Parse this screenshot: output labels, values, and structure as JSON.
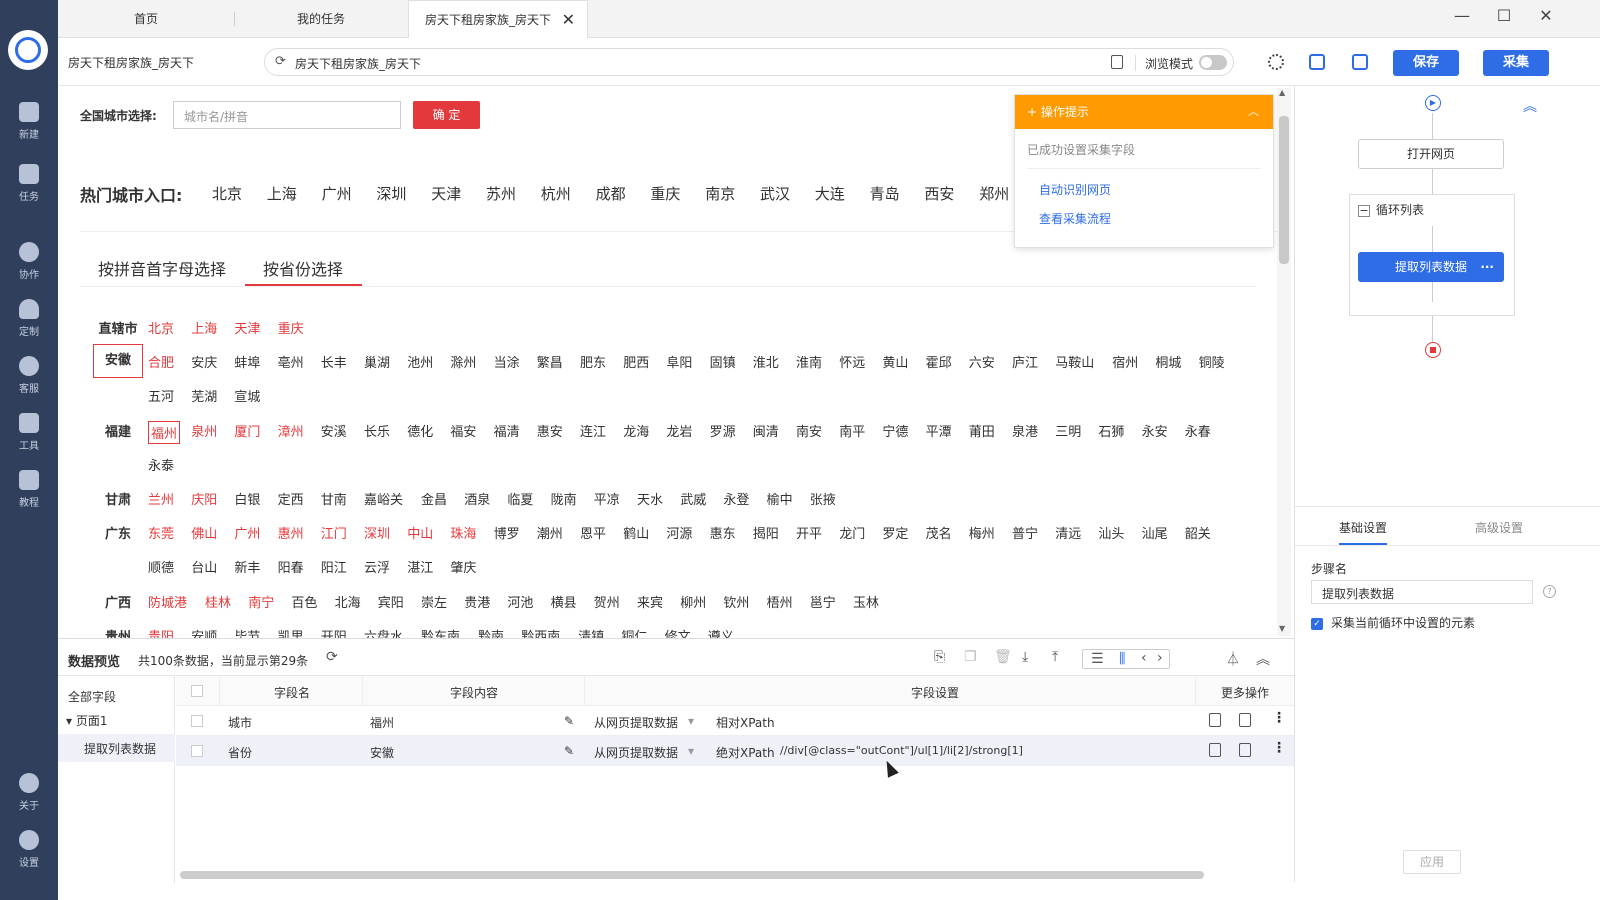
{
  "tabs": {
    "home": "首页",
    "my_tasks": "我的任务",
    "active": "房天下租房家族_房天下"
  },
  "sidebar": {
    "items": [
      {
        "label": "新建"
      },
      {
        "label": "任务"
      },
      {
        "label": "协作"
      },
      {
        "label": "定制"
      },
      {
        "label": "客服"
      },
      {
        "label": "工具"
      },
      {
        "label": "教程"
      },
      {
        "label": "关于"
      },
      {
        "label": "设置"
      }
    ]
  },
  "address": {
    "page_title": "房天下租房家族_房天下",
    "url": "房天下租房家族_房天下",
    "browse_mode": "浏览模式",
    "save": "保存",
    "collect": "采集"
  },
  "web": {
    "city_select_label": "全国城市选择:",
    "city_input_placeholder": "城市名/拼音",
    "confirm": "确 定",
    "hot_label": "热门城市入口:",
    "hot_cities": [
      "北京",
      "上海",
      "广州",
      "深圳",
      "天津",
      "苏州",
      "杭州",
      "成都",
      "重庆",
      "南京",
      "武汉",
      "大连",
      "青岛",
      "西安",
      "郑州"
    ],
    "tab_pinyin": "按拼音首字母选择",
    "tab_province": "按省份选择",
    "provinces": [
      {
        "name": "直辖市",
        "rows": [
          [
            {
              "t": "北京",
              "r": 1
            },
            {
              "t": "上海",
              "r": 1
            },
            {
              "t": "天津",
              "r": 1
            },
            {
              "t": "重庆",
              "r": 1
            }
          ]
        ]
      },
      {
        "name": "安徽",
        "rows": [
          [
            {
              "t": "合肥",
              "r": 1
            },
            {
              "t": "安庆"
            },
            {
              "t": "蚌埠"
            },
            {
              "t": "亳州"
            },
            {
              "t": "长丰"
            },
            {
              "t": "巢湖"
            },
            {
              "t": "池州"
            },
            {
              "t": "滁州"
            },
            {
              "t": "当涂"
            },
            {
              "t": "繁昌"
            },
            {
              "t": "肥东"
            },
            {
              "t": "肥西"
            },
            {
              "t": "阜阳"
            },
            {
              "t": "固镇"
            },
            {
              "t": "淮北"
            },
            {
              "t": "淮南"
            },
            {
              "t": "怀远"
            },
            {
              "t": "黄山"
            },
            {
              "t": "霍邱"
            },
            {
              "t": "六安"
            },
            {
              "t": "庐江"
            },
            {
              "t": "马鞍山"
            },
            {
              "t": "宿州"
            },
            {
              "t": "桐城"
            },
            {
              "t": "铜陵"
            }
          ],
          [
            {
              "t": "五河"
            },
            {
              "t": "芜湖"
            },
            {
              "t": "宣城"
            }
          ]
        ]
      },
      {
        "name": "福建",
        "rows": [
          [
            {
              "t": "福州",
              "r": 1
            },
            {
              "t": "泉州",
              "r": 1
            },
            {
              "t": "厦门",
              "r": 1
            },
            {
              "t": "漳州",
              "r": 1
            },
            {
              "t": "安溪"
            },
            {
              "t": "长乐"
            },
            {
              "t": "德化"
            },
            {
              "t": "福安"
            },
            {
              "t": "福清"
            },
            {
              "t": "惠安"
            },
            {
              "t": "连江"
            },
            {
              "t": "龙海"
            },
            {
              "t": "龙岩"
            },
            {
              "t": "罗源"
            },
            {
              "t": "闽清"
            },
            {
              "t": "南安"
            },
            {
              "t": "南平"
            },
            {
              "t": "宁德"
            },
            {
              "t": "平潭"
            },
            {
              "t": "莆田"
            },
            {
              "t": "泉港"
            },
            {
              "t": "三明"
            },
            {
              "t": "石狮"
            },
            {
              "t": "永安"
            },
            {
              "t": "永春"
            }
          ],
          [
            {
              "t": "永泰"
            }
          ]
        ]
      },
      {
        "name": "甘肃",
        "rows": [
          [
            {
              "t": "兰州",
              "r": 1
            },
            {
              "t": "庆阳",
              "r": 1
            },
            {
              "t": "白银"
            },
            {
              "t": "定西"
            },
            {
              "t": "甘南"
            },
            {
              "t": "嘉峪关"
            },
            {
              "t": "金昌"
            },
            {
              "t": "酒泉"
            },
            {
              "t": "临夏"
            },
            {
              "t": "陇南"
            },
            {
              "t": "平凉"
            },
            {
              "t": "天水"
            },
            {
              "t": "武威"
            },
            {
              "t": "永登"
            },
            {
              "t": "榆中"
            },
            {
              "t": "张掖"
            }
          ]
        ]
      },
      {
        "name": "广东",
        "rows": [
          [
            {
              "t": "东莞",
              "r": 1
            },
            {
              "t": "佛山",
              "r": 1
            },
            {
              "t": "广州",
              "r": 1
            },
            {
              "t": "惠州",
              "r": 1
            },
            {
              "t": "江门",
              "r": 1
            },
            {
              "t": "深圳",
              "r": 1
            },
            {
              "t": "中山",
              "r": 1
            },
            {
              "t": "珠海",
              "r": 1
            },
            {
              "t": "博罗"
            },
            {
              "t": "潮州"
            },
            {
              "t": "恩平"
            },
            {
              "t": "鹤山"
            },
            {
              "t": "河源"
            },
            {
              "t": "惠东"
            },
            {
              "t": "揭阳"
            },
            {
              "t": "开平"
            },
            {
              "t": "龙门"
            },
            {
              "t": "罗定"
            },
            {
              "t": "茂名"
            },
            {
              "t": "梅州"
            },
            {
              "t": "普宁"
            },
            {
              "t": "清远"
            },
            {
              "t": "汕头"
            },
            {
              "t": "汕尾"
            },
            {
              "t": "韶关"
            }
          ],
          [
            {
              "t": "顺德"
            },
            {
              "t": "台山"
            },
            {
              "t": "新丰"
            },
            {
              "t": "阳春"
            },
            {
              "t": "阳江"
            },
            {
              "t": "云浮"
            },
            {
              "t": "湛江"
            },
            {
              "t": "肇庆"
            }
          ]
        ]
      },
      {
        "name": "广西",
        "rows": [
          [
            {
              "t": "防城港",
              "r": 1
            },
            {
              "t": "桂林",
              "r": 1
            },
            {
              "t": "南宁",
              "r": 1
            },
            {
              "t": "百色"
            },
            {
              "t": "北海"
            },
            {
              "t": "宾阳"
            },
            {
              "t": "崇左"
            },
            {
              "t": "贵港"
            },
            {
              "t": "河池"
            },
            {
              "t": "横县"
            },
            {
              "t": "贺州"
            },
            {
              "t": "来宾"
            },
            {
              "t": "柳州"
            },
            {
              "t": "钦州"
            },
            {
              "t": "梧州"
            },
            {
              "t": "邕宁"
            },
            {
              "t": "玉林"
            }
          ]
        ]
      },
      {
        "name": "贵州",
        "rows": [
          [
            {
              "t": "贵阳",
              "r": 1
            },
            {
              "t": "安顺"
            },
            {
              "t": "毕节"
            },
            {
              "t": "凯里"
            },
            {
              "t": "开阳"
            },
            {
              "t": "六盘水"
            },
            {
              "t": "黔东南"
            },
            {
              "t": "黔南"
            },
            {
              "t": "黔西南"
            },
            {
              "t": "清镇"
            },
            {
              "t": "铜仁"
            },
            {
              "t": "修文"
            },
            {
              "t": "遵义"
            }
          ]
        ]
      }
    ]
  },
  "hint": {
    "title": "操作提示",
    "done": "已成功设置采集字段",
    "link_auto": "自动识别网页",
    "link_flow": "查看采集流程"
  },
  "flow": {
    "open_page": "打开网页",
    "loop_list": "循环列表",
    "extract": "提取列表数据",
    "tab_basic": "基础设置",
    "tab_advanced": "高级设置",
    "step_name_label": "步骤名",
    "step_name_value": "提取列表数据",
    "checkbox_label": "采集当前循环中设置的元素",
    "apply": "应用"
  },
  "preview": {
    "title": "数据预览",
    "count": "共100条数据，当前显示第29条",
    "all_fields": "全部字段",
    "page1": "页面1",
    "extract_item": "提取列表数据",
    "headers": [
      "字段名",
      "字段内容",
      "字段设置",
      "更多操作"
    ],
    "rows": [
      {
        "name": "城市",
        "content": "福州",
        "source": "从网页提取数据",
        "xpath_type": "相对XPath",
        "xpath": ""
      },
      {
        "name": "省份",
        "content": "安徽",
        "source": "从网页提取数据",
        "xpath_type": "绝对XPath",
        "xpath": "//div[@class=\"outCont\"]/ul[1]/li[2]/strong[1]"
      }
    ]
  },
  "colors": {
    "sidebar_bg": "#2f3f5c",
    "primary_blue": "#2f6de6",
    "brand_red": "#e4393c",
    "hint_orange": "#ff9b00"
  }
}
